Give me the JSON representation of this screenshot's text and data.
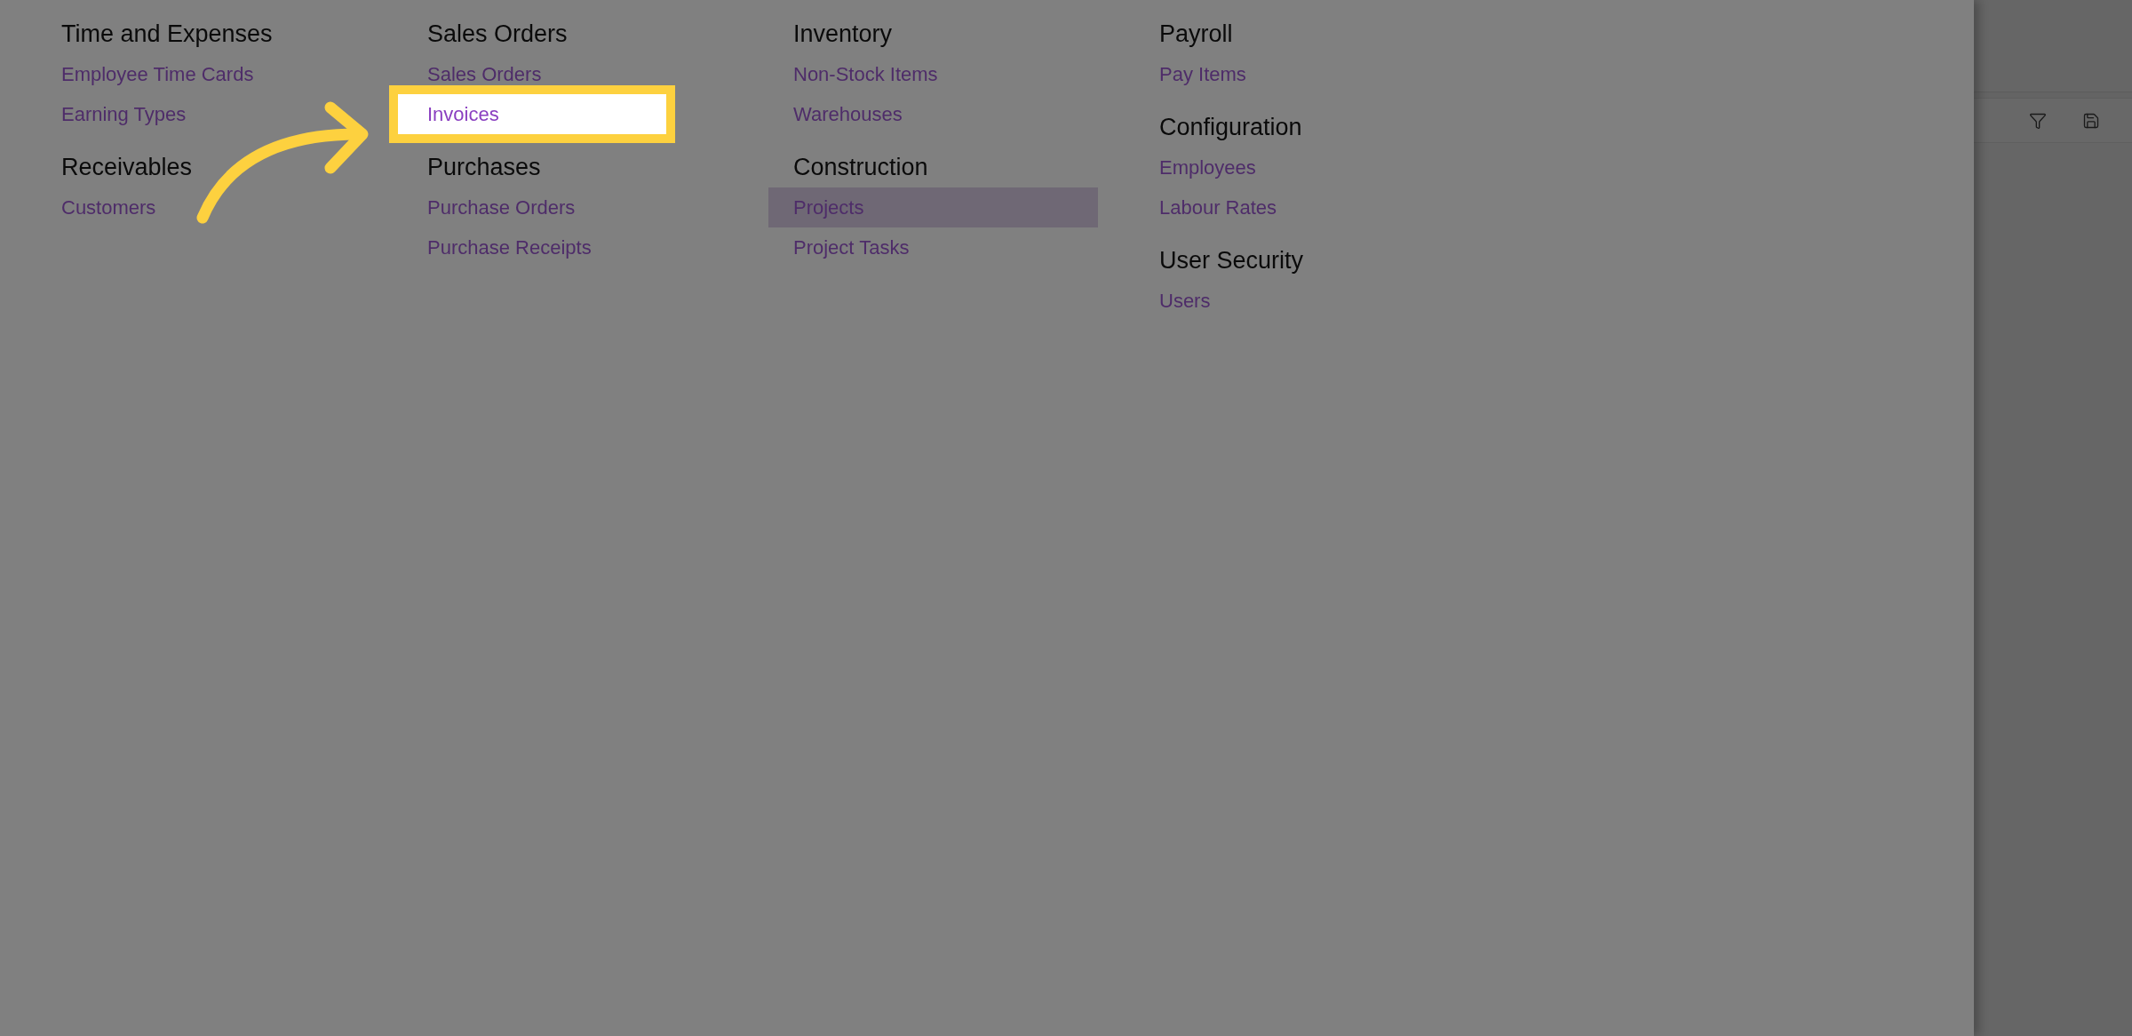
{
  "menu": {
    "columns": [
      {
        "groups": [
          {
            "title": "Time and Expenses",
            "items": [
              {
                "label": "Employee Time Cards",
                "spotlighted": false,
                "hovered": false
              },
              {
                "label": "Earning Types",
                "spotlighted": false,
                "hovered": false
              }
            ]
          },
          {
            "title": "Receivables",
            "items": [
              {
                "label": "Customers",
                "spotlighted": false,
                "hovered": false
              }
            ]
          }
        ]
      },
      {
        "groups": [
          {
            "title": "Sales Orders",
            "items": [
              {
                "label": "Sales Orders",
                "spotlighted": false,
                "hovered": false
              },
              {
                "label": "Invoices",
                "spotlighted": true,
                "hovered": false
              }
            ]
          },
          {
            "title": "Purchases",
            "items": [
              {
                "label": "Purchase Orders",
                "spotlighted": false,
                "hovered": false
              },
              {
                "label": "Purchase Receipts",
                "spotlighted": false,
                "hovered": false
              }
            ]
          }
        ]
      },
      {
        "groups": [
          {
            "title": "Inventory",
            "items": [
              {
                "label": "Non-Stock Items",
                "spotlighted": false,
                "hovered": false
              },
              {
                "label": "Warehouses",
                "spotlighted": false,
                "hovered": false
              }
            ]
          },
          {
            "title": "Construction",
            "items": [
              {
                "label": "Projects",
                "spotlighted": false,
                "hovered": true
              },
              {
                "label": "Project Tasks",
                "spotlighted": false,
                "hovered": false
              }
            ]
          }
        ]
      },
      {
        "groups": [
          {
            "title": "Payroll",
            "items": [
              {
                "label": "Pay Items",
                "spotlighted": false,
                "hovered": false
              }
            ]
          },
          {
            "title": "Configuration",
            "items": [
              {
                "label": "Employees",
                "spotlighted": false,
                "hovered": false
              },
              {
                "label": "Labour Rates",
                "spotlighted": false,
                "hovered": false
              }
            ]
          },
          {
            "title": "User Security",
            "items": [
              {
                "label": "Users",
                "spotlighted": false,
                "hovered": false
              }
            ]
          }
        ]
      }
    ]
  }
}
